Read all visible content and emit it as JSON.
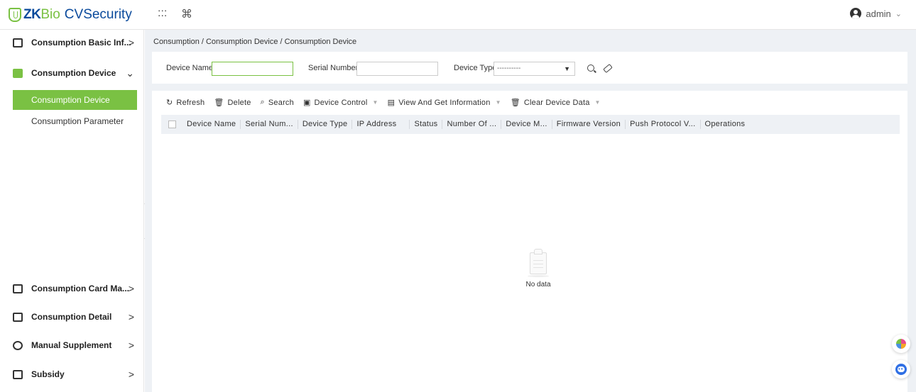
{
  "app": {
    "logo_zk": "ZK",
    "logo_bio": "Bio",
    "logo_cv": "CVSecurity",
    "grid_icon": ":::",
    "cmd_icon": "⌘",
    "user_name": "admin",
    "user_chevron": "⌄"
  },
  "sidebar": {
    "menus": [
      {
        "label": "Consumption Basic Inf...",
        "icon": "calendar-icon",
        "chevron": ">"
      },
      {
        "label": "Consumption Device",
        "icon": "device-icon",
        "chevron": "⌄"
      },
      {
        "label": "Consumption Card Ma...",
        "icon": "card-icon",
        "chevron": ">"
      },
      {
        "label": "Consumption Detail",
        "icon": "detail-icon",
        "chevron": ">"
      },
      {
        "label": "Manual Supplement",
        "icon": "supplement-icon",
        "chevron": ">"
      },
      {
        "label": "Subsidy",
        "icon": "subsidy-icon",
        "chevron": ">"
      }
    ],
    "submenus": [
      {
        "label": "Consumption Device",
        "active": true
      },
      {
        "label": "Consumption Parameter",
        "active": false
      }
    ],
    "collapse_glyph": "«"
  },
  "breadcrumb": "Consumption / Consumption Device / Consumption Device",
  "filters": {
    "device_name_label": "Device Name",
    "device_name_value": "",
    "serial_number_label": "Serial Number",
    "serial_number_value": "",
    "device_type_label": "Device Type",
    "device_type_value": "----------",
    "device_type_caret": "▼"
  },
  "toolbar": {
    "refresh": "Refresh",
    "delete": "Delete",
    "search": "Search",
    "device_control": "Device Control",
    "view_info": "View And Get Information",
    "clear_data": "Clear Device Data",
    "drop_glyph": "▼"
  },
  "table": {
    "columns": [
      "Device Name",
      "Serial Num...",
      "Device Type",
      "IP Address",
      "Status",
      "Number Of ...",
      "Device M...",
      "Firmware Version",
      "Push Protocol V...",
      "Operations"
    ],
    "empty_text": "No data"
  },
  "colors": {
    "accent": "#7ac143",
    "brand_blue": "#0a4a9c",
    "main_bg": "#eef1f5"
  }
}
